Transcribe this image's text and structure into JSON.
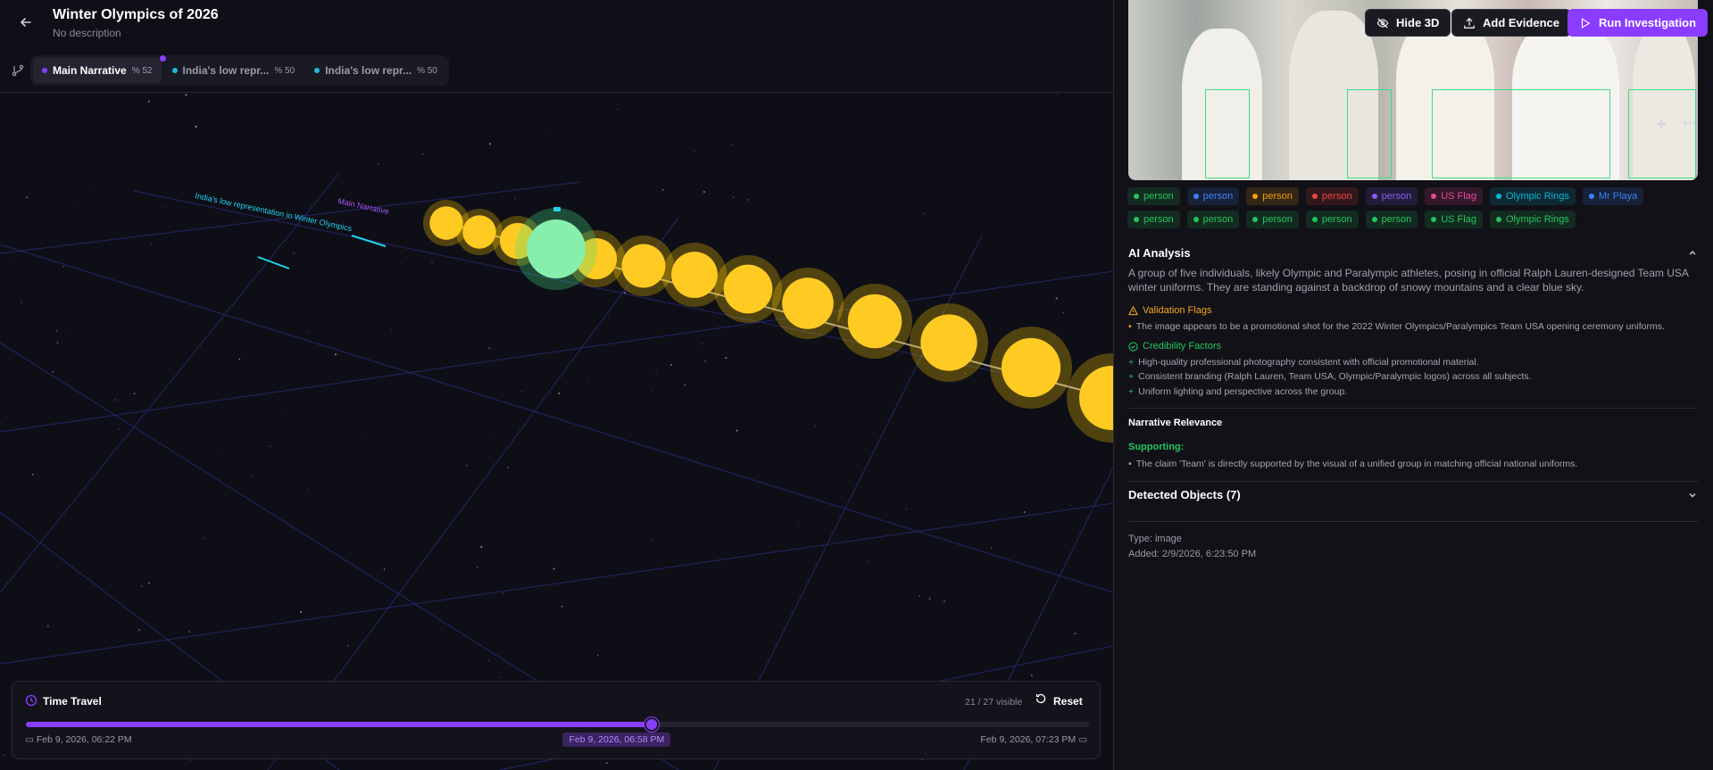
{
  "header": {
    "title": "Winter Olympics of 2026",
    "subtitle": "No description"
  },
  "tabs": [
    {
      "label": "Main Narrative",
      "pct": "% 52",
      "color": "#8b3dff",
      "active": true
    },
    {
      "label": "India's low repr...",
      "pct": "% 50",
      "color": "#22b7d6",
      "active": false
    },
    {
      "label": "India's low repr...",
      "pct": "% 50",
      "color": "#22b7d6",
      "active": false
    }
  ],
  "buttons": {
    "hide3d": "Hide 3D",
    "add_evidence": "Add Evidence",
    "run_investigation": "Run Investigation"
  },
  "scene": {
    "label_1": "India's low representation in Winter Olympics",
    "label_2": "Main Narrative"
  },
  "tags": [
    {
      "label": "person",
      "color": "#22c55e"
    },
    {
      "label": "person",
      "color": "#3b82f6"
    },
    {
      "label": "person",
      "color": "#f59e0b"
    },
    {
      "label": "person",
      "color": "#ef4444"
    },
    {
      "label": "person",
      "color": "#8b5cf6"
    },
    {
      "label": "US Flag",
      "color": "#ec4899"
    },
    {
      "label": "Olympic Rings",
      "color": "#06b6d4"
    },
    {
      "label": "Mr Playa",
      "color": "#3b82f6"
    },
    {
      "label": "person",
      "color": "#22c55e"
    },
    {
      "label": "person",
      "color": "#22c55e"
    },
    {
      "label": "person",
      "color": "#22c55e"
    },
    {
      "label": "person",
      "color": "#22c55e"
    },
    {
      "label": "person",
      "color": "#22c55e"
    },
    {
      "label": "US Flag",
      "color": "#22c55e"
    },
    {
      "label": "Olympic Rings",
      "color": "#22c55e"
    }
  ],
  "ai": {
    "heading": "AI Analysis",
    "description": "A group of five individuals, likely Olympic and Paralympic athletes, posing in official Ralph Lauren-designed Team USA winter uniforms. They are standing against a backdrop of snowy mountains and a clear blue sky.",
    "validation_heading": "Validation Flags",
    "validation_items": [
      "The image appears to be a promotional shot for the 2022 Winter Olympics/Paralympics Team USA opening ceremony uniforms."
    ],
    "credibility_heading": "Credibility Factors",
    "credibility_items": [
      "High-quality professional photography consistent with official promotional material.",
      "Consistent branding (Ralph Lauren, Team USA, Olympic/Paralympic logos) across all subjects.",
      "Uniform lighting and perspective across the group."
    ],
    "relevance_heading": "Narrative Relevance",
    "supporting_heading": "Supporting:",
    "supporting_items": [
      "The claim 'Team' is directly supported by the visual of a unified group in matching official national uniforms."
    ],
    "detected_heading": "Detected Objects (7)",
    "type": "Type: image",
    "added": "Added: 2/9/2026, 6:23:50 PM"
  },
  "time_travel": {
    "title": "Time Travel",
    "visible": "21 / 27 visible",
    "reset": "Reset",
    "start": "Feb 9, 2026, 06:22 PM",
    "current": "Feb 9, 2026, 06:58 PM",
    "end": "Feb 9, 2026, 07:23 PM",
    "progress": 0.589
  }
}
